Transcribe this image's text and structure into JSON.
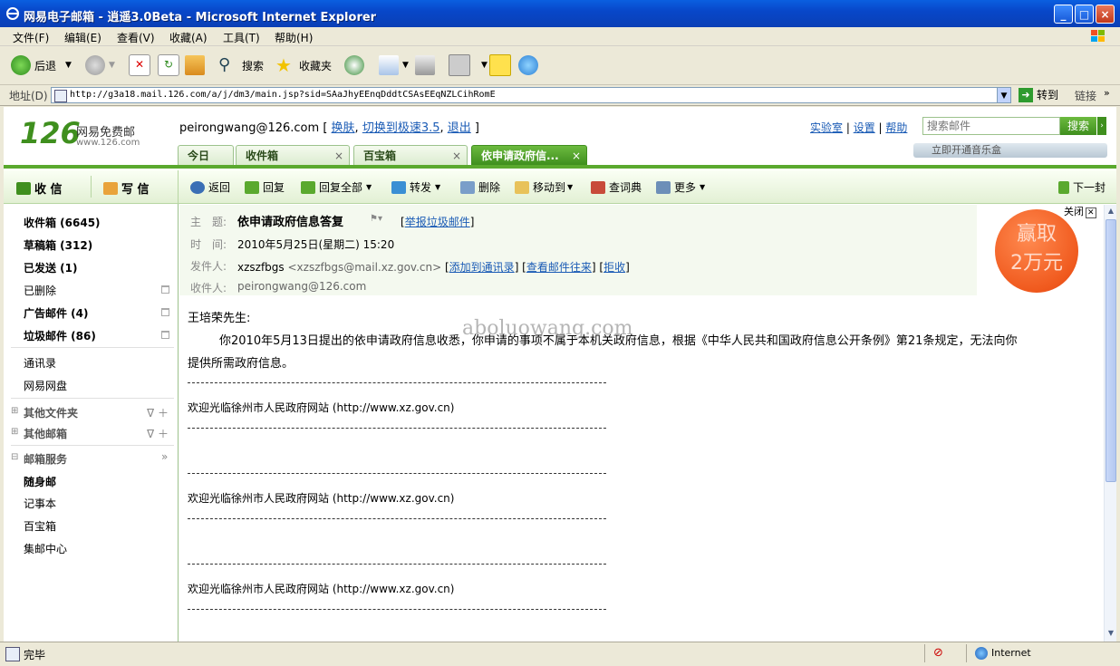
{
  "window": {
    "title": "网易电子邮箱 - 逍遥3.0Beta - Microsoft Internet Explorer",
    "controls": [
      "_",
      "□",
      "×"
    ]
  },
  "menu": [
    "文件(F)",
    "编辑(E)",
    "查看(V)",
    "收藏(A)",
    "工具(T)",
    "帮助(H)"
  ],
  "toolbar": {
    "back": "后退",
    "search": "搜索",
    "favorites": "收藏夹"
  },
  "address": {
    "label": "地址(D)",
    "url": "http://g3a18.mail.126.com/a/j/dm3/main.jsp?sid=SAaJhyEEnqDddtCSAsEEqNZLCihRomE",
    "go": "转到",
    "links": "链接"
  },
  "header": {
    "logo_num": "126",
    "logo_text": "网易免费邮",
    "logo_url": "www.126.com",
    "account": "peirongwang@126.com",
    "links": [
      "换肤",
      "切换到极速3.5",
      "退出"
    ],
    "top_links": [
      "实验室",
      "设置",
      "帮助"
    ],
    "search_placeholder": "搜索邮件",
    "search_button": "搜索",
    "music": "立即开通音乐盒"
  },
  "tabs": [
    {
      "label": "今日"
    },
    {
      "label": "收件箱"
    },
    {
      "label": "百宝箱"
    },
    {
      "label": "依申请政府信..."
    }
  ],
  "actions": {
    "receive": "收 信",
    "compose": "写 信",
    "back": "返回",
    "reply": "回复",
    "reply_all": "回复全部",
    "forward": "转发",
    "delete": "删除",
    "move": "移动到",
    "dict": "查词典",
    "more": "更多",
    "next": "下一封"
  },
  "sidebar": {
    "folders": [
      {
        "label": "收件箱 (6645)"
      },
      {
        "label": "草稿箱 (312)"
      },
      {
        "label": "已发送 (1)"
      },
      {
        "label": "已删除"
      },
      {
        "label": "广告邮件 (4)"
      },
      {
        "label": "垃圾邮件 (86)"
      }
    ],
    "contacts": "通讯录",
    "netdisk": "网易网盘",
    "other_folders": "其他文件夹",
    "other_mail": "其他邮箱",
    "services": "邮箱服务",
    "service_items": [
      "随身邮",
      "记事本",
      "百宝箱",
      "集邮中心"
    ]
  },
  "mail": {
    "subject_label": "主　题:",
    "subject": "依申请政府信息答复",
    "report": "举报垃圾邮件",
    "time_label": "时　间:",
    "time": "2010年5月25日(星期二) 15:20",
    "from_label": "发件人:",
    "from_name": "xzszfbgs",
    "from_addr": "<xzszfbgs@mail.xz.gov.cn>",
    "from_links": [
      "添加到通讯录",
      "查看邮件往来",
      "拒收"
    ],
    "to_label": "收件人:",
    "to": "peirongwang@126.com",
    "close": "关闭",
    "promo_line1": "赢取",
    "promo_line2": "2万元",
    "greeting": "王培荣先生:",
    "para1": "你2010年5月13日提出的依申请政府信息收悉，你申请的事项不属于本机关政府信息，根据《中华人民共和国政府信息公开条例》第21条规定，无法向你",
    "para2": "提供所需政府信息。",
    "footer_text": "欢迎光临徐州市人民政府网站 (http://www.xz.gov.cn)",
    "watermark": "aboluowang.com"
  },
  "status": {
    "done": "完毕",
    "zone": "Internet"
  },
  "colors": {
    "accent_green": "#5aa92e",
    "xp_blue": "#0a5fe0",
    "link": "#1a5bb5",
    "promo": "#f05a1e"
  }
}
